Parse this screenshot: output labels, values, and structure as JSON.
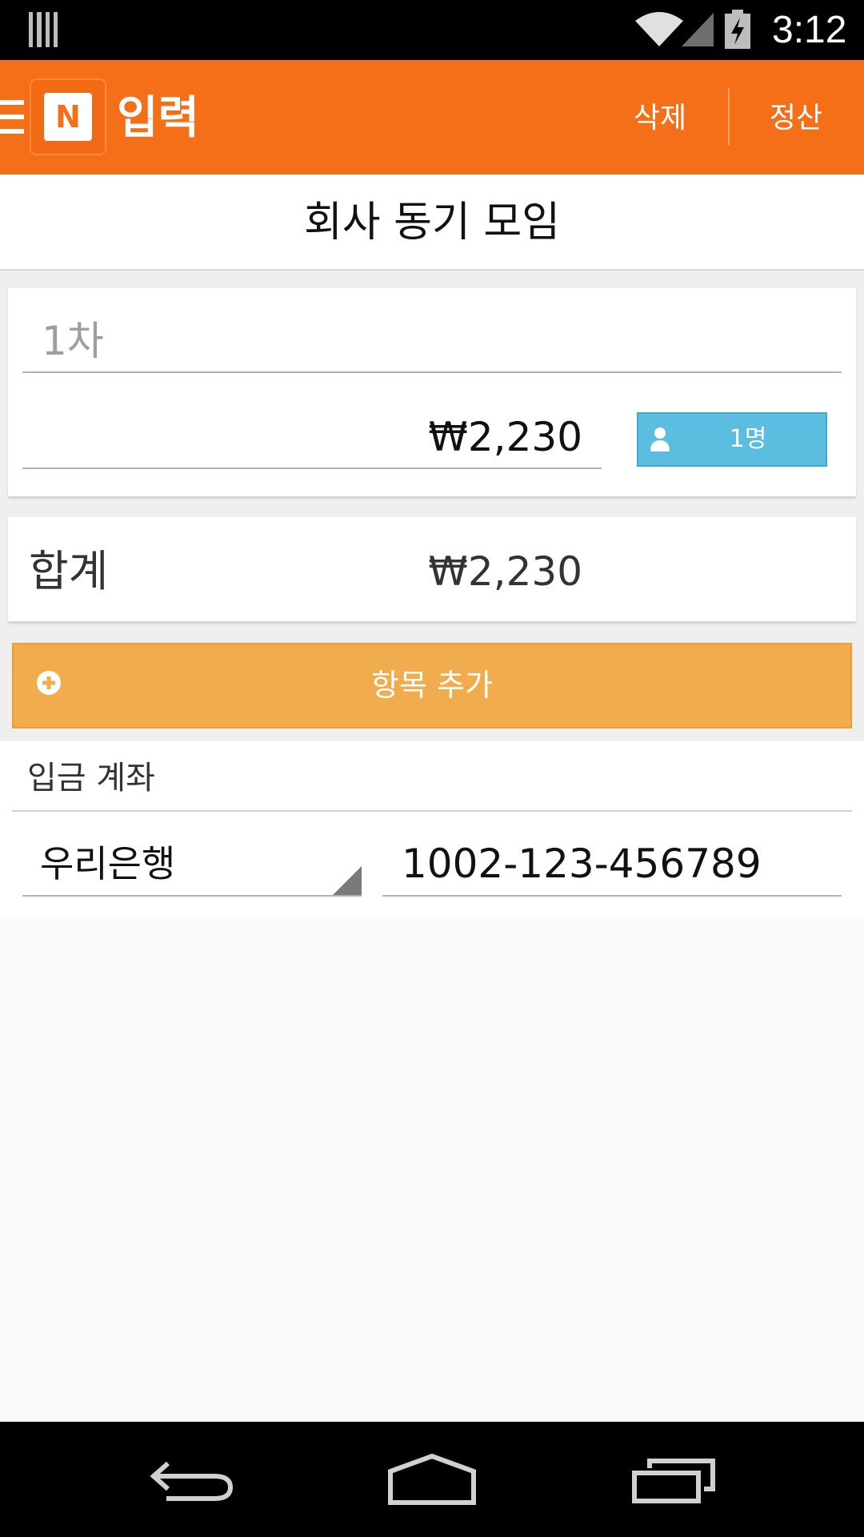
{
  "status_bar": {
    "time": "3:12"
  },
  "app_bar": {
    "logo_letter": "N",
    "title": "입력",
    "delete_label": "삭제",
    "settle_label": "정산"
  },
  "group": {
    "title": "회사 동기 모임"
  },
  "round": {
    "name_placeholder": "1차",
    "amount": "₩2,230",
    "people_label": "1명"
  },
  "total": {
    "label": "합계",
    "value": "₩2,230"
  },
  "add_item": {
    "label": "항목 추가"
  },
  "account": {
    "title": "입금 계좌",
    "bank": "우리은행",
    "number": "1002-123-456789"
  },
  "colors": {
    "app_bar": "#f56f19",
    "people_button": "#5bbde0",
    "add_button": "#f0ac4d"
  },
  "icons": {
    "status": [
      "notification-icon",
      "wifi-icon",
      "signal-icon",
      "battery-icon"
    ],
    "app_bar": [
      "menu-icon",
      "app-logo-icon"
    ],
    "content": [
      "person-icon",
      "plus-circle-icon",
      "dropdown-arrow-icon"
    ],
    "navigation": [
      "back-icon",
      "home-icon",
      "recent-apps-icon"
    ]
  }
}
